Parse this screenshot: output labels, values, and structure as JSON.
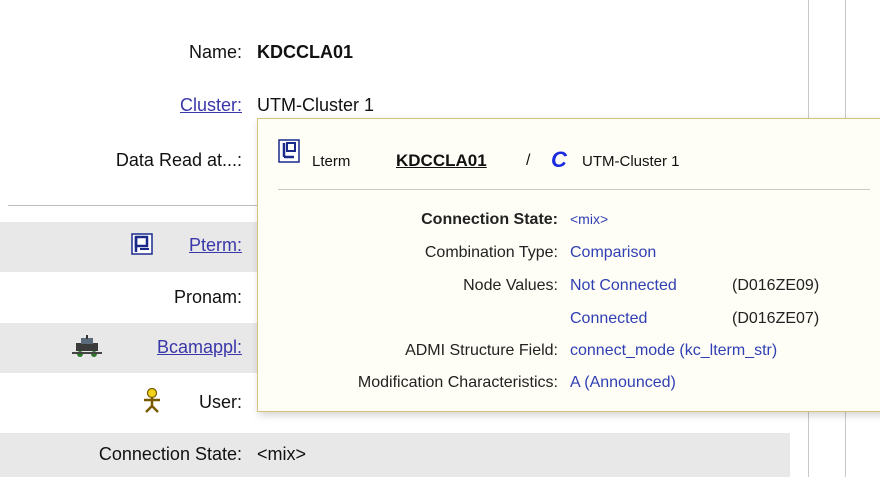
{
  "form": {
    "name_label": "Name:",
    "name_value": "KDCCLA01",
    "cluster_label": "Cluster:",
    "cluster_value": "UTM-Cluster 1",
    "data_read_label": "Data Read at...:",
    "pterm_label": "Pterm:",
    "pronam_label": "Pronam:",
    "bcamappl_label": "Bcamappl:",
    "user_label": "User:",
    "connection_state_label": "Connection State:",
    "connection_state_value": "<mix>"
  },
  "tooltip": {
    "object_type": "Lterm",
    "object_name": "KDCCLA01",
    "separator": "/",
    "cluster_name": "UTM-Cluster 1",
    "rows": [
      {
        "key": "Connection State:",
        "value": "<mix>"
      },
      {
        "key": "Combination Type:",
        "value": "Comparison"
      },
      {
        "key": "Node Values:",
        "value": "Not Connected",
        "node": "(D016ZE09)"
      },
      {
        "key": "",
        "value": "Connected",
        "node": "(D016ZE07)"
      },
      {
        "key": "ADMI Structure Field:",
        "value": "connect_mode (kc_lterm_str)"
      },
      {
        "key": "Modification Characteristics:",
        "value": "A (Announced)"
      }
    ]
  },
  "colors": {
    "link": "#3a37a8",
    "tooltip_value": "#2f3fb3",
    "tooltip_bg": "#fffef6",
    "band": "#e8e8e8"
  },
  "icons": {
    "pterm": "pterm-icon",
    "bcamappl": "bcamappl-icon",
    "user": "user-icon",
    "lterm": "lterm-icon",
    "cluster": "cluster-icon"
  }
}
